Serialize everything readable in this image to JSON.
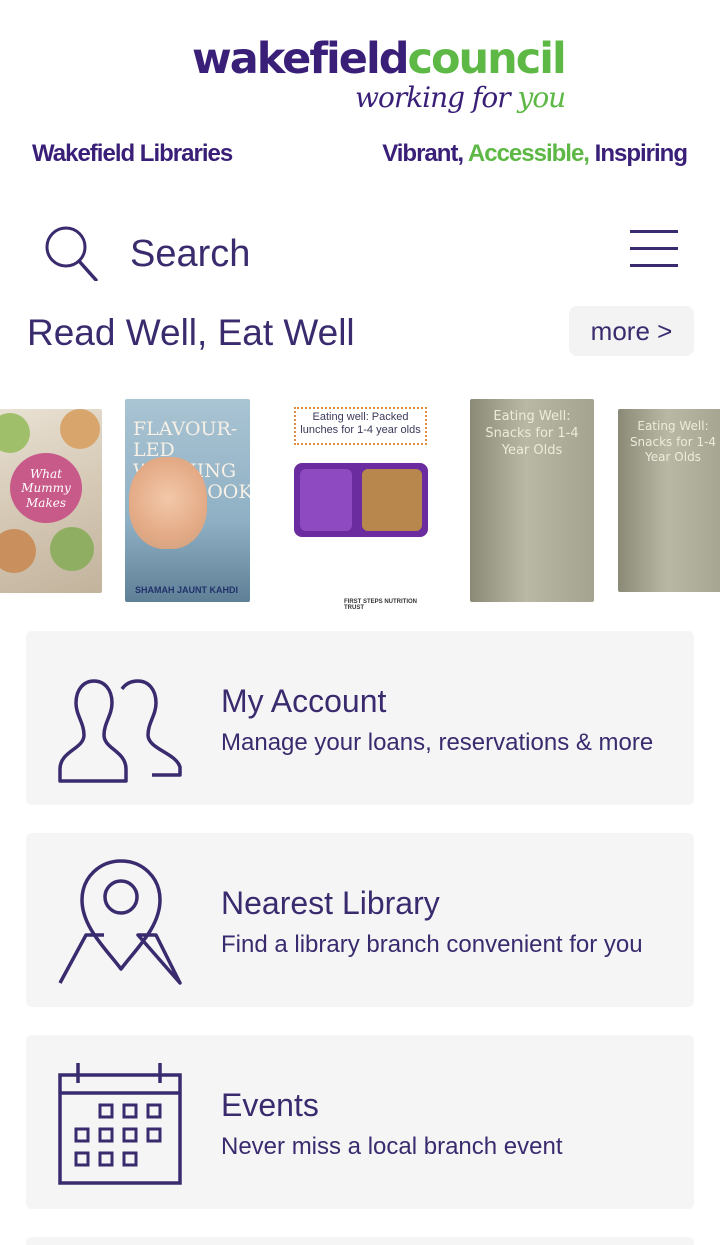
{
  "header": {
    "logo_part1": "wakefield",
    "logo_part2": "council",
    "logo_tag1": "working for",
    "logo_tag2": "you",
    "libraries_label": "Wakefield Libraries",
    "motto_word1": "Vibrant,",
    "motto_word2": "Accessible,",
    "motto_word3": "Inspiring",
    "brand_purple": "#3a1f78",
    "brand_green": "#5db845"
  },
  "search": {
    "label": "Search",
    "icon": "search-icon",
    "menu_icon": "hamburger-menu-icon"
  },
  "carousel": {
    "title": "Read Well, Eat Well",
    "more_label": "more >",
    "books": [
      {
        "cover_text": "What Mummy Makes"
      },
      {
        "cover_text": "FLAVOUR-LED WEANING COOKBOOK",
        "author_text": "SHAMAH JAUNT KAHDI"
      },
      {
        "cover_text": "Eating well: Packed lunches for 1-4 year olds",
        "footer_text": "FIRST STEPS NUTRITION TRUST"
      },
      {
        "cover_text": "Eating Well: Snacks for 1-4 Year Olds"
      },
      {
        "cover_text": "Eating Well: Snacks for 1-4 Year Olds"
      }
    ]
  },
  "cards": [
    {
      "title": "My Account",
      "subtitle": "Manage your loans, reservations & more",
      "icon": "users-icon"
    },
    {
      "title": "Nearest Library",
      "subtitle": "Find a library branch convenient for you",
      "icon": "map-pin-icon"
    },
    {
      "title": "Events",
      "subtitle": "Never miss a local branch event",
      "icon": "calendar-icon"
    }
  ]
}
